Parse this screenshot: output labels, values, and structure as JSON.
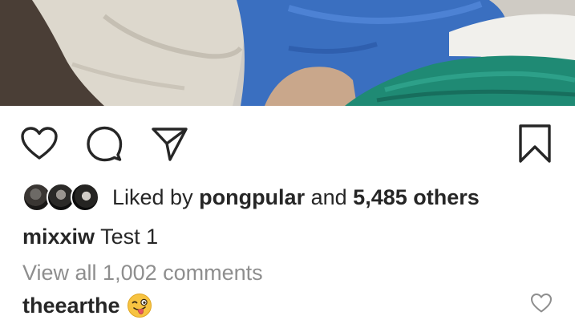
{
  "post": {
    "image_alt": "",
    "likes": {
      "prefix": "Liked by",
      "first_liker": "pongpular",
      "connector": "and",
      "others": "5,485 others"
    },
    "caption": {
      "username": "mixxiw",
      "text": "Test 1"
    },
    "view_comments_label": "View all 1,002 comments",
    "comments": [
      {
        "username": "theearthe",
        "emoji": "winking-face-with-tongue"
      }
    ]
  },
  "icons": {
    "like": "heart-icon",
    "comment": "comment-bubble-icon",
    "share": "paper-plane-icon",
    "save": "bookmark-icon",
    "comment_like": "small-heart-icon"
  },
  "colors": {
    "text": "#262626",
    "muted": "#8e8e8e",
    "background": "#ffffff"
  }
}
